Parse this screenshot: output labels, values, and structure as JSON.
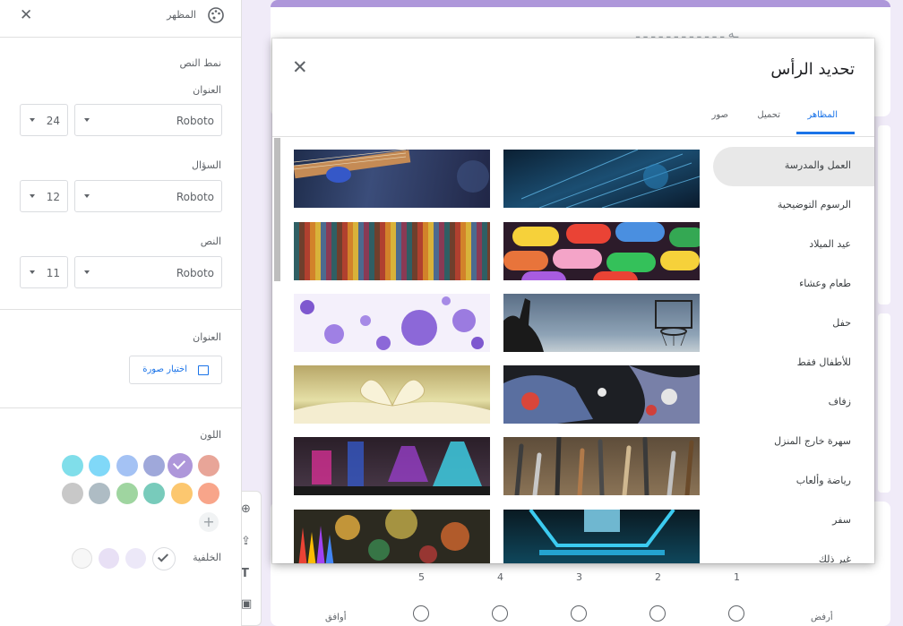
{
  "sidebar": {
    "title": "المظهر",
    "text_style_label": "نمط النص",
    "heading_label": "العنوان",
    "heading_font": "Roboto",
    "heading_size": "24",
    "question_label": "السؤال",
    "question_font": "Roboto",
    "question_size": "12",
    "text_label": "النص",
    "text_font": "Roboto",
    "text_size": "11",
    "header_label": "العنوان",
    "choose_image": "اختيار صورة",
    "color_label": "اللون",
    "background_label": "الخلفية",
    "plus": "+",
    "colors": [
      "#e8a598",
      "#ae97da",
      "#9fa8da",
      "#a4c2f4",
      "#80d8f8",
      "#80deea",
      "#f8a58a",
      "#fcc76f",
      "#78cbbb",
      "#9fd5a0",
      "#aebcc4",
      "#c8c8c8"
    ],
    "backgrounds": [
      "#ffffff",
      "#ece8f8",
      "#e8e0f5",
      "#f7f7f7"
    ]
  },
  "modal": {
    "title": "تحديد الرأس",
    "tabs": [
      "المظاهر",
      "تحميل",
      "صور"
    ],
    "categories": [
      "العمل والمدرسة",
      "الرسوم التوضيحية",
      "عيد الميلاد",
      "طعام وعشاء",
      "حفل",
      "للأطفال فقط",
      "زفاف",
      "سهرة خارج المنزل",
      "رياضة وألعاب",
      "سفر",
      "غير ذلك"
    ]
  },
  "form": {
    "scale_numbers": [
      "1",
      "2",
      "3",
      "4",
      "5"
    ],
    "scale_low": "أرفض",
    "scale_high": "أوافق"
  }
}
